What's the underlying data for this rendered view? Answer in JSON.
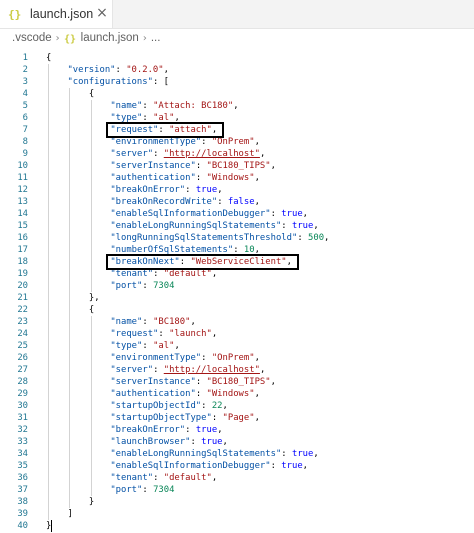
{
  "tab": {
    "label": "launch.json",
    "icon": "json-braces-icon",
    "close_label": "×",
    "accent": "#cbcb41"
  },
  "breadcrumb": {
    "folder": ".vscode",
    "file": "launch.json",
    "more": "...",
    "separator": "›"
  },
  "colors": {
    "key": "#0451a5",
    "string": "#a31515",
    "number": "#098658",
    "keyword": "#0000ff",
    "line_number": "#237893"
  },
  "highlight_lines": [
    7,
    18
  ],
  "lines": [
    {
      "no": "1",
      "indent": 0,
      "tokens": [
        [
          "p",
          "{"
        ]
      ]
    },
    {
      "no": "2",
      "indent": 1,
      "tokens": [
        [
          "k",
          "\"version\""
        ],
        [
          "p",
          ": "
        ],
        [
          "s",
          "\"0.2.0\""
        ],
        [
          "p",
          ","
        ]
      ]
    },
    {
      "no": "3",
      "indent": 1,
      "tokens": [
        [
          "k",
          "\"configurations\""
        ],
        [
          "p",
          ": ["
        ]
      ]
    },
    {
      "no": "4",
      "indent": 2,
      "tokens": [
        [
          "p",
          "{"
        ]
      ]
    },
    {
      "no": "5",
      "indent": 3,
      "tokens": [
        [
          "k",
          "\"name\""
        ],
        [
          "p",
          ": "
        ],
        [
          "s",
          "\"Attach: BC180\""
        ],
        [
          "p",
          ","
        ]
      ]
    },
    {
      "no": "6",
      "indent": 3,
      "tokens": [
        [
          "k",
          "\"type\""
        ],
        [
          "p",
          ": "
        ],
        [
          "s",
          "\"al\""
        ],
        [
          "p",
          ","
        ]
      ]
    },
    {
      "no": "7",
      "indent": 3,
      "tokens": [
        [
          "k",
          "\"request\""
        ],
        [
          "p",
          ": "
        ],
        [
          "s",
          "\"attach\""
        ],
        [
          "p",
          ","
        ]
      ]
    },
    {
      "no": "8",
      "indent": 3,
      "tokens": [
        [
          "k",
          "\"environmentType\""
        ],
        [
          "p",
          ": "
        ],
        [
          "s",
          "\"OnPrem\""
        ],
        [
          "p",
          ","
        ]
      ]
    },
    {
      "no": "9",
      "indent": 3,
      "tokens": [
        [
          "k",
          "\"server\""
        ],
        [
          "p",
          ": "
        ],
        [
          "s",
          "\"http://localhost\""
        ],
        [
          "p",
          ","
        ]
      ]
    },
    {
      "no": "10",
      "indent": 3,
      "tokens": [
        [
          "k",
          "\"serverInstance\""
        ],
        [
          "p",
          ": "
        ],
        [
          "s",
          "\"BC180_TIPS\""
        ],
        [
          "p",
          ","
        ]
      ]
    },
    {
      "no": "11",
      "indent": 3,
      "tokens": [
        [
          "k",
          "\"authentication\""
        ],
        [
          "p",
          ": "
        ],
        [
          "s",
          "\"Windows\""
        ],
        [
          "p",
          ","
        ]
      ]
    },
    {
      "no": "12",
      "indent": 3,
      "tokens": [
        [
          "k",
          "\"breakOnError\""
        ],
        [
          "p",
          ": "
        ],
        [
          "kw",
          "true"
        ],
        [
          "p",
          ","
        ]
      ]
    },
    {
      "no": "13",
      "indent": 3,
      "tokens": [
        [
          "k",
          "\"breakOnRecordWrite\""
        ],
        [
          "p",
          ": "
        ],
        [
          "kw",
          "false"
        ],
        [
          "p",
          ","
        ]
      ]
    },
    {
      "no": "14",
      "indent": 3,
      "tokens": [
        [
          "k",
          "\"enableSqlInformationDebugger\""
        ],
        [
          "p",
          ": "
        ],
        [
          "kw",
          "true"
        ],
        [
          "p",
          ","
        ]
      ]
    },
    {
      "no": "15",
      "indent": 3,
      "tokens": [
        [
          "k",
          "\"enableLongRunningSqlStatements\""
        ],
        [
          "p",
          ": "
        ],
        [
          "kw",
          "true"
        ],
        [
          "p",
          ","
        ]
      ]
    },
    {
      "no": "16",
      "indent": 3,
      "tokens": [
        [
          "k",
          "\"longRunningSqlStatementsThreshold\""
        ],
        [
          "p",
          ": "
        ],
        [
          "n",
          "500"
        ],
        [
          "p",
          ","
        ]
      ]
    },
    {
      "no": "17",
      "indent": 3,
      "tokens": [
        [
          "k",
          "\"numberOfSqlStatements\""
        ],
        [
          "p",
          ": "
        ],
        [
          "n",
          "10"
        ],
        [
          "p",
          ","
        ]
      ]
    },
    {
      "no": "18",
      "indent": 3,
      "tokens": [
        [
          "k",
          "\"breakOnNext\""
        ],
        [
          "p",
          ": "
        ],
        [
          "s",
          "\"WebServiceClient\""
        ],
        [
          "p",
          ","
        ]
      ]
    },
    {
      "no": "19",
      "indent": 3,
      "tokens": [
        [
          "k",
          "\"tenant\""
        ],
        [
          "p",
          ": "
        ],
        [
          "s",
          "\"default\""
        ],
        [
          "p",
          ","
        ]
      ]
    },
    {
      "no": "20",
      "indent": 3,
      "tokens": [
        [
          "k",
          "\"port\""
        ],
        [
          "p",
          ": "
        ],
        [
          "n",
          "7304"
        ]
      ]
    },
    {
      "no": "21",
      "indent": 2,
      "tokens": [
        [
          "p",
          "},"
        ]
      ]
    },
    {
      "no": "22",
      "indent": 2,
      "tokens": [
        [
          "p",
          "{"
        ]
      ]
    },
    {
      "no": "23",
      "indent": 3,
      "tokens": [
        [
          "k",
          "\"name\""
        ],
        [
          "p",
          ": "
        ],
        [
          "s",
          "\"BC180\""
        ],
        [
          "p",
          ","
        ]
      ]
    },
    {
      "no": "24",
      "indent": 3,
      "tokens": [
        [
          "k",
          "\"request\""
        ],
        [
          "p",
          ": "
        ],
        [
          "s",
          "\"launch\""
        ],
        [
          "p",
          ","
        ]
      ]
    },
    {
      "no": "25",
      "indent": 3,
      "tokens": [
        [
          "k",
          "\"type\""
        ],
        [
          "p",
          ": "
        ],
        [
          "s",
          "\"al\""
        ],
        [
          "p",
          ","
        ]
      ]
    },
    {
      "no": "26",
      "indent": 3,
      "tokens": [
        [
          "k",
          "\"environmentType\""
        ],
        [
          "p",
          ": "
        ],
        [
          "s",
          "\"OnPrem\""
        ],
        [
          "p",
          ","
        ]
      ]
    },
    {
      "no": "27",
      "indent": 3,
      "tokens": [
        [
          "k",
          "\"server\""
        ],
        [
          "p",
          ": "
        ],
        [
          "s",
          "\"http://localhost\""
        ],
        [
          "p",
          ","
        ]
      ]
    },
    {
      "no": "28",
      "indent": 3,
      "tokens": [
        [
          "k",
          "\"serverInstance\""
        ],
        [
          "p",
          ": "
        ],
        [
          "s",
          "\"BC180_TIPS\""
        ],
        [
          "p",
          ","
        ]
      ]
    },
    {
      "no": "29",
      "indent": 3,
      "tokens": [
        [
          "k",
          "\"authentication\""
        ],
        [
          "p",
          ": "
        ],
        [
          "s",
          "\"Windows\""
        ],
        [
          "p",
          ","
        ]
      ]
    },
    {
      "no": "30",
      "indent": 3,
      "tokens": [
        [
          "k",
          "\"startupObjectId\""
        ],
        [
          "p",
          ": "
        ],
        [
          "n",
          "22"
        ],
        [
          "p",
          ","
        ]
      ]
    },
    {
      "no": "31",
      "indent": 3,
      "tokens": [
        [
          "k",
          "\"startupObjectType\""
        ],
        [
          "p",
          ": "
        ],
        [
          "s",
          "\"Page\""
        ],
        [
          "p",
          ","
        ]
      ]
    },
    {
      "no": "32",
      "indent": 3,
      "tokens": [
        [
          "k",
          "\"breakOnError\""
        ],
        [
          "p",
          ": "
        ],
        [
          "kw",
          "true"
        ],
        [
          "p",
          ","
        ]
      ]
    },
    {
      "no": "33",
      "indent": 3,
      "tokens": [
        [
          "k",
          "\"launchBrowser\""
        ],
        [
          "p",
          ": "
        ],
        [
          "kw",
          "true"
        ],
        [
          "p",
          ","
        ]
      ]
    },
    {
      "no": "34",
      "indent": 3,
      "tokens": [
        [
          "k",
          "\"enableLongRunningSqlStatements\""
        ],
        [
          "p",
          ": "
        ],
        [
          "kw",
          "true"
        ],
        [
          "p",
          ","
        ]
      ]
    },
    {
      "no": "35",
      "indent": 3,
      "tokens": [
        [
          "k",
          "\"enableSqlInformationDebugger\""
        ],
        [
          "p",
          ": "
        ],
        [
          "kw",
          "true"
        ],
        [
          "p",
          ","
        ]
      ]
    },
    {
      "no": "36",
      "indent": 3,
      "tokens": [
        [
          "k",
          "\"tenant\""
        ],
        [
          "p",
          ": "
        ],
        [
          "s",
          "\"default\""
        ],
        [
          "p",
          ","
        ]
      ]
    },
    {
      "no": "37",
      "indent": 3,
      "tokens": [
        [
          "k",
          "\"port\""
        ],
        [
          "p",
          ": "
        ],
        [
          "n",
          "7304"
        ]
      ]
    },
    {
      "no": "38",
      "indent": 2,
      "tokens": [
        [
          "p",
          "}"
        ]
      ]
    },
    {
      "no": "39",
      "indent": 1,
      "tokens": [
        [
          "p",
          "]"
        ]
      ]
    },
    {
      "no": "40",
      "indent": 0,
      "tokens": [
        [
          "p",
          "}"
        ]
      ]
    }
  ]
}
